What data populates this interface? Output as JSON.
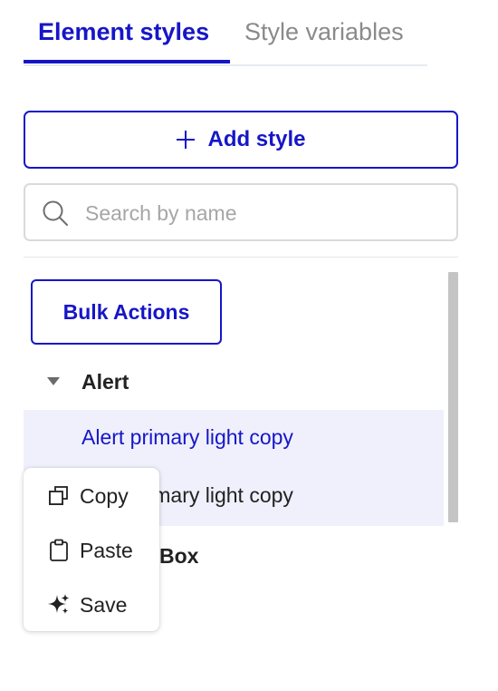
{
  "tabs": [
    {
      "label": "Element styles",
      "active": true
    },
    {
      "label": "Style variables",
      "active": false
    }
  ],
  "add_style": {
    "label": "Add style",
    "icon": "plus-icon"
  },
  "search": {
    "placeholder": "Search by name",
    "value": "",
    "icon": "search-icon"
  },
  "bulk_actions": {
    "label": "Bulk Actions"
  },
  "tree": {
    "groups": [
      {
        "label": "Alert",
        "expanded": true,
        "items": [
          {
            "label": "Alert primary light copy",
            "selected": true
          },
          {
            "label": "Alert primary light copy",
            "selected": false
          }
        ]
      },
      {
        "label": "Box",
        "expanded": false,
        "items": []
      }
    ]
  },
  "context_menu": {
    "items": [
      {
        "label": "Copy",
        "icon": "copy-icon"
      },
      {
        "label": "Paste",
        "icon": "clipboard-icon"
      },
      {
        "label": "Save",
        "icon": "sparkle-icon"
      }
    ]
  },
  "colors": {
    "accent": "#1616c8",
    "selected_row_bg": "#eff0fb",
    "border_gray": "#d8dadd",
    "inactive_text": "#8a8a8a",
    "scrollbar": "#c4c4c4"
  }
}
